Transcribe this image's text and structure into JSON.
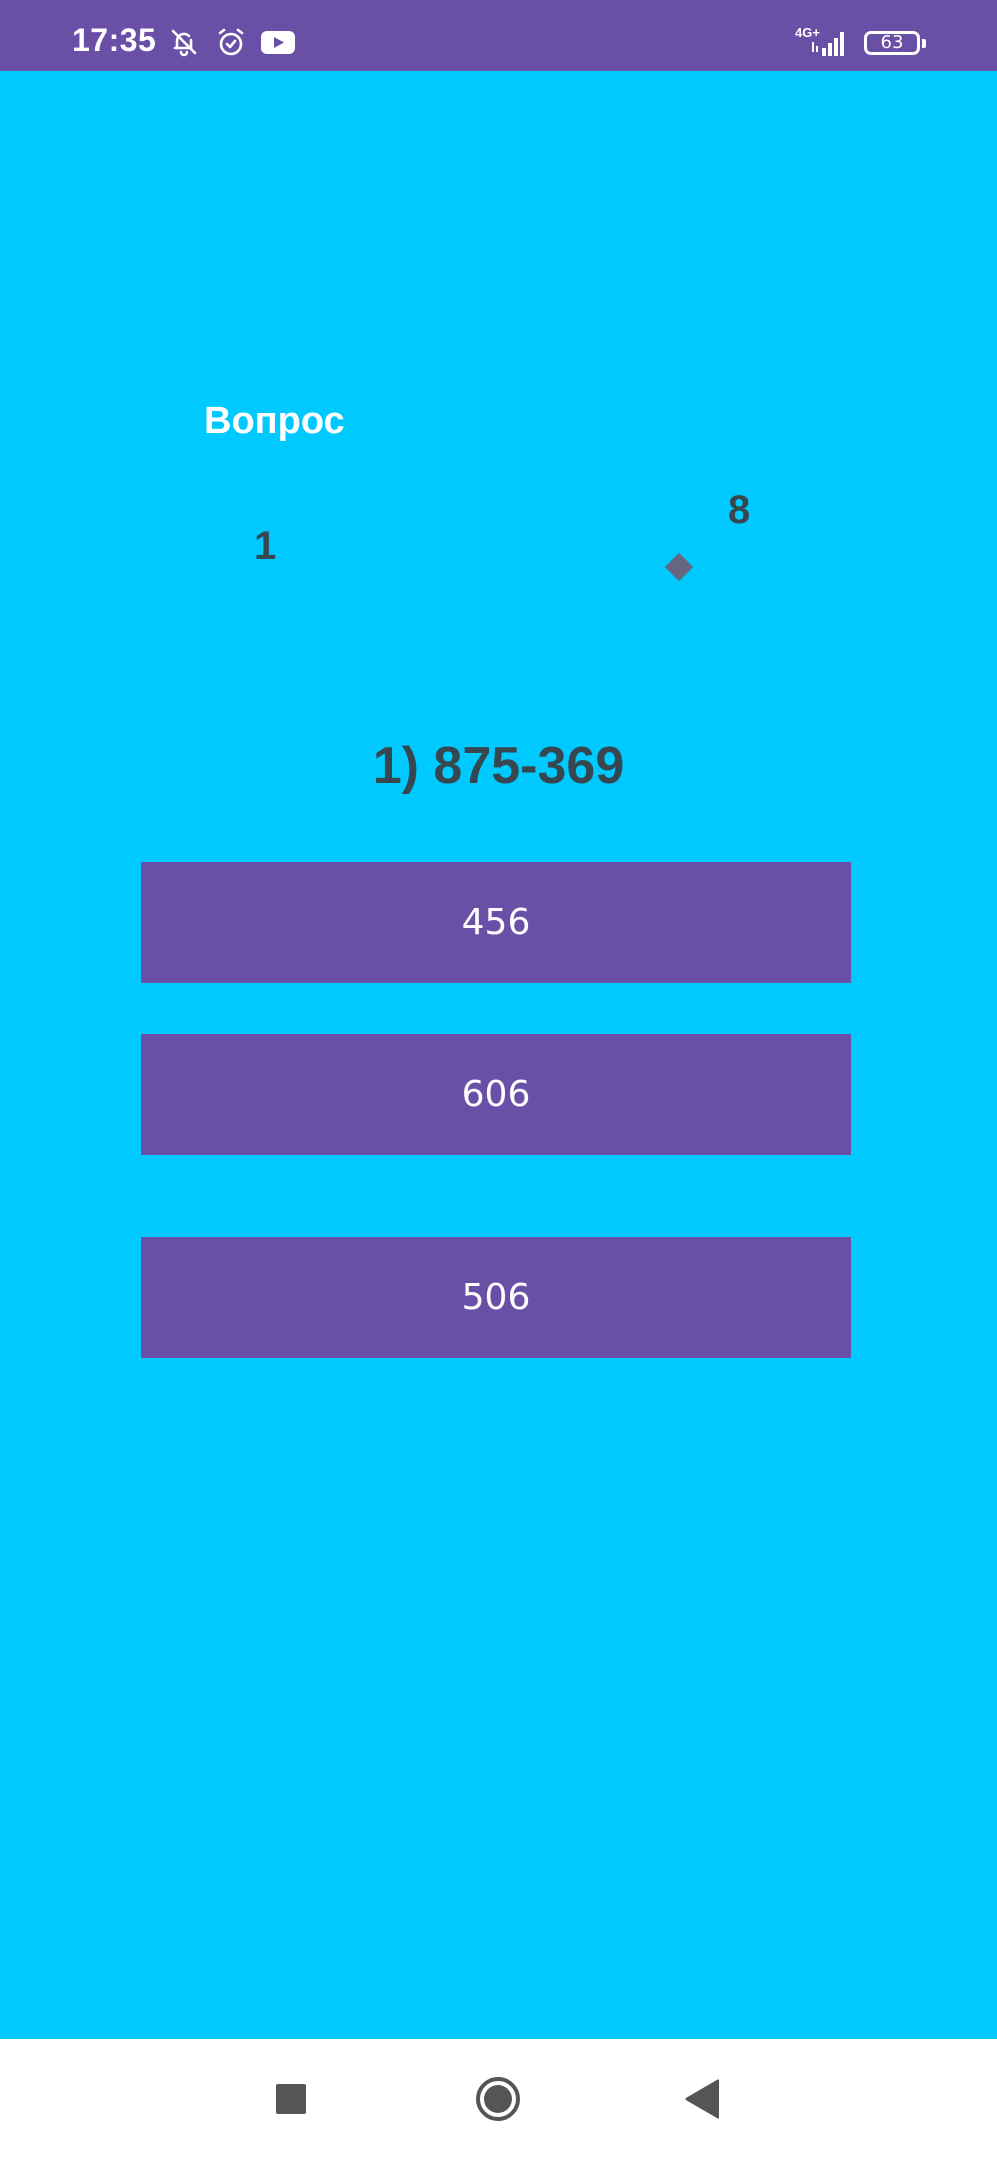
{
  "status_bar": {
    "time": "17:35",
    "icons": [
      "notifications-off-icon",
      "alarm-icon",
      "youtube-icon"
    ],
    "network": "4G+",
    "signal_icon": "signal-icon",
    "battery": "63"
  },
  "quiz": {
    "label": "Вопрос",
    "current": "1",
    "total": "8",
    "question": "1) 875-369",
    "answers": [
      "456",
      "606",
      "506"
    ]
  },
  "nav_bar": {
    "icons": [
      "recent-apps-icon",
      "home-icon",
      "back-icon"
    ]
  },
  "colors": {
    "background": "#00C9FF",
    "bars": "#6A4FA7",
    "text_dark": "#37474F",
    "button": "#6A4FA7",
    "button_text": "#FFFFFF"
  }
}
